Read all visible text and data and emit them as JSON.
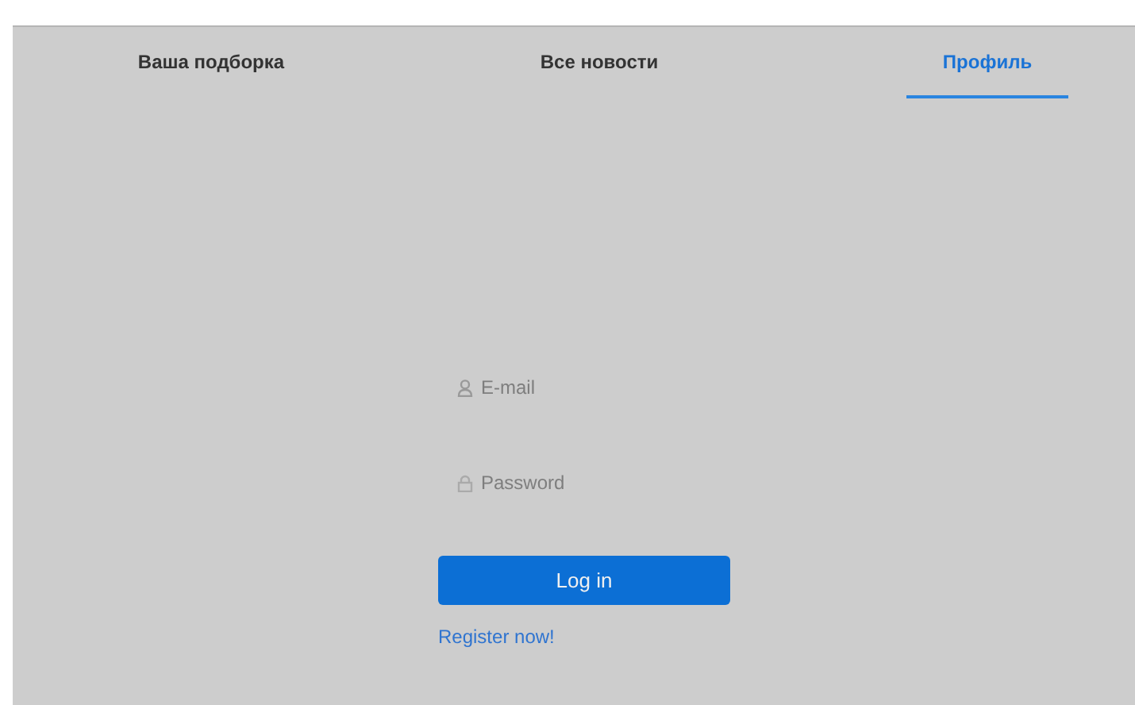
{
  "tabs": [
    {
      "label": "Ваша подборка",
      "selected": false
    },
    {
      "label": "Все новости",
      "selected": false
    },
    {
      "label": "Профиль",
      "selected": true
    }
  ],
  "login": {
    "email": {
      "placeholder": "E-mail"
    },
    "password": {
      "placeholder": "Password"
    },
    "submit": "Log in",
    "register": "Register now!"
  }
}
